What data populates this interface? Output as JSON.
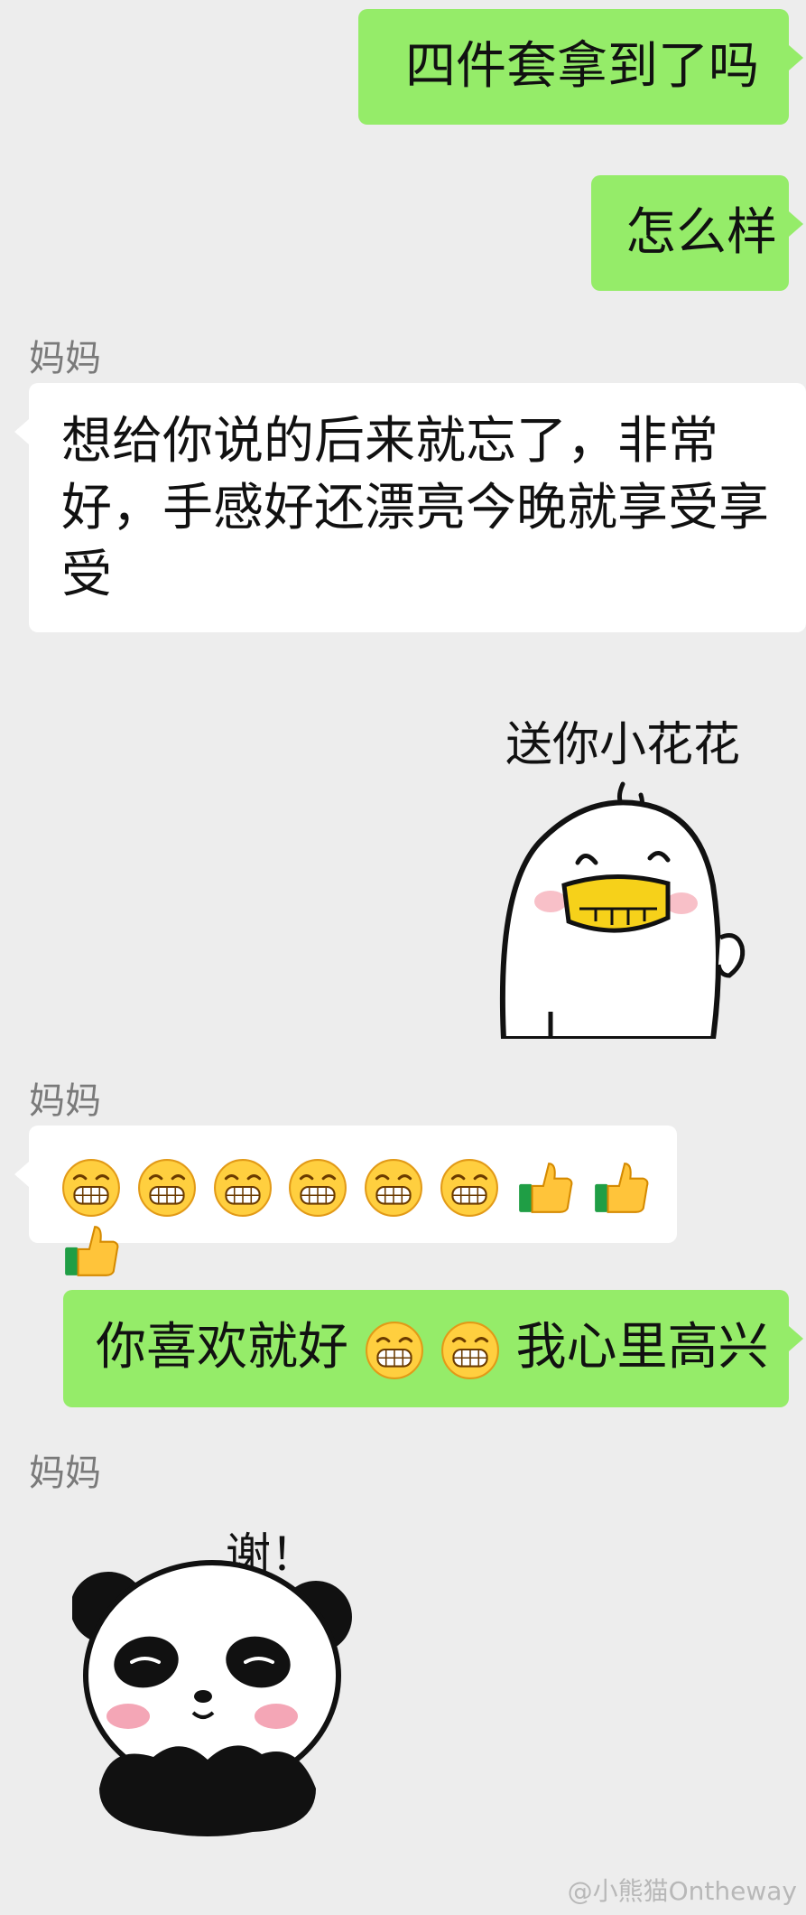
{
  "messages": {
    "m1": "四件套拿到了吗",
    "m2": "怎么样",
    "sender1": "妈妈",
    "m3": "想给你说的后来就忘了，非常好，手感好还漂亮今晚就享受享受",
    "sticker1_text": "送你小花花",
    "sender2": "妈妈",
    "sender3": "妈妈",
    "m5_text_a": "你喜欢就好",
    "m5_text_b": "我心里高兴",
    "sticker2_text": "谢！"
  },
  "emoji": {
    "grin": "grinning-face-icon",
    "thumb": "thumbs-up-icon"
  },
  "watermark": "@小熊猫Ontheway",
  "colors": {
    "background": "#ededed",
    "outgoing": "#95ec69",
    "incoming": "#ffffff"
  }
}
